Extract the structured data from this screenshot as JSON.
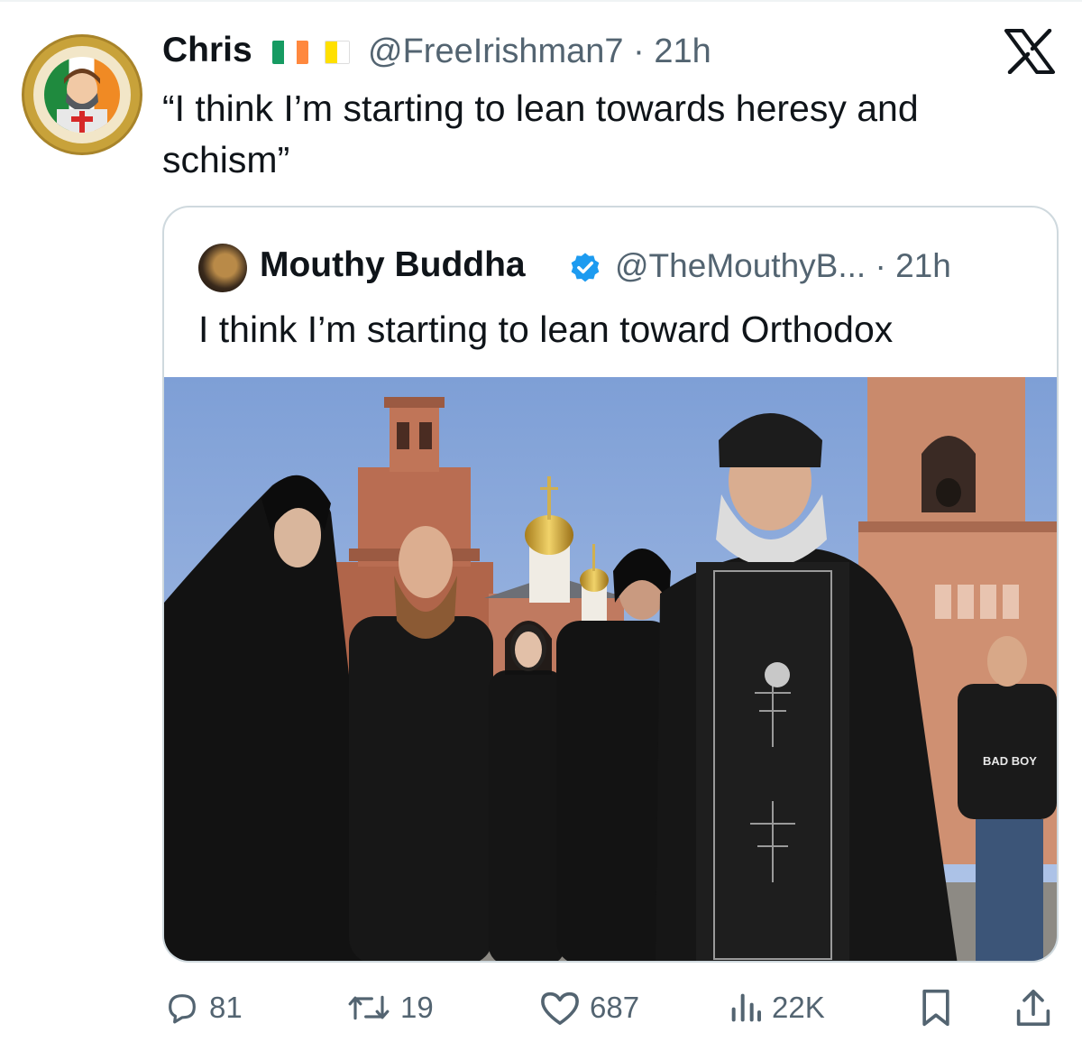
{
  "tweet": {
    "author_name": "Chris",
    "handle": "@FreeIrishman7",
    "separator": "·",
    "time": "21h",
    "text": "“I think I’m starting to lean towards heresy and schism”",
    "avatar_icon": "saint-patrick-badge-avatar",
    "flags": [
      "irish-flag",
      "vatican-flag"
    ]
  },
  "quote": {
    "author_name": "Mouthy Buddha",
    "verified": true,
    "handle": "@TheMouthyB...",
    "separator": "·",
    "time": "21h",
    "text": "I think I’m starting to lean toward Orthodox",
    "photo_label": "BAD BOY"
  },
  "actions": {
    "replies": "81",
    "reposts": "19",
    "likes": "687",
    "views": "22K"
  },
  "colors": {
    "text_primary": "#0f1419",
    "text_secondary": "#536471",
    "verified_blue": "#1d9bf0",
    "border": "#cfd9de"
  }
}
